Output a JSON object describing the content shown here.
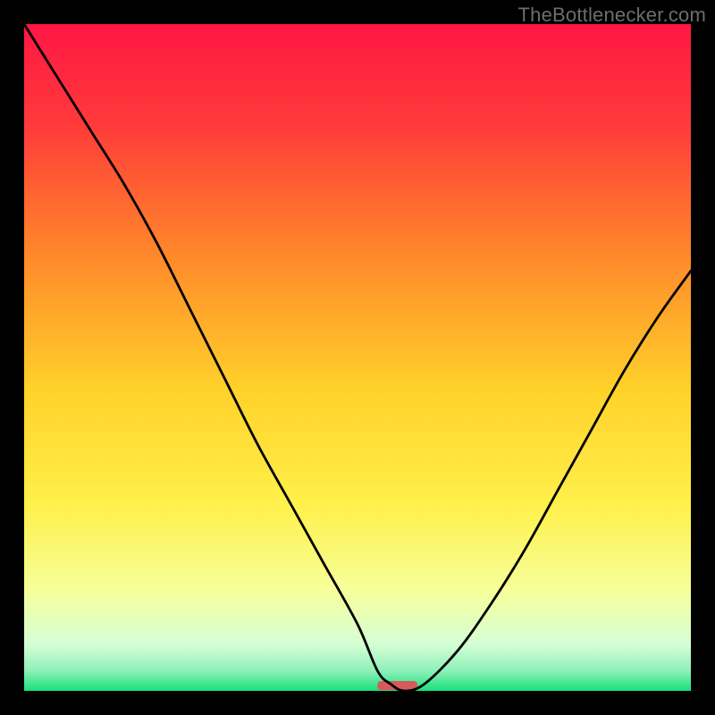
{
  "watermark": "TheBottlenecker.com",
  "chart_data": {
    "type": "line",
    "title": "",
    "xlabel": "",
    "ylabel": "",
    "xlim": [
      0,
      100
    ],
    "ylim": [
      0,
      100
    ],
    "x": [
      0,
      5,
      10,
      15,
      20,
      25,
      30,
      35,
      40,
      45,
      50,
      53,
      55,
      57,
      60,
      65,
      70,
      75,
      80,
      85,
      90,
      95,
      100
    ],
    "values": [
      100,
      92,
      84,
      76,
      67,
      57,
      47,
      37,
      28,
      19,
      10,
      3,
      1,
      0,
      1,
      6,
      13,
      21,
      30,
      39,
      48,
      56,
      63
    ],
    "curve_color": "#000000",
    "marker": {
      "x": 56,
      "width": 6,
      "color": "#d65a5a"
    },
    "gradient_stops": [
      {
        "offset": 0.0,
        "color": "#ff1744"
      },
      {
        "offset": 0.15,
        "color": "#ff3a3a"
      },
      {
        "offset": 0.35,
        "color": "#ff8a2a"
      },
      {
        "offset": 0.55,
        "color": "#ffd22a"
      },
      {
        "offset": 0.72,
        "color": "#fff04a"
      },
      {
        "offset": 0.85,
        "color": "#f6ff9a"
      },
      {
        "offset": 0.93,
        "color": "#d6ffd6"
      },
      {
        "offset": 0.97,
        "color": "#8ef0b8"
      },
      {
        "offset": 1.0,
        "color": "#18e07a"
      }
    ]
  }
}
